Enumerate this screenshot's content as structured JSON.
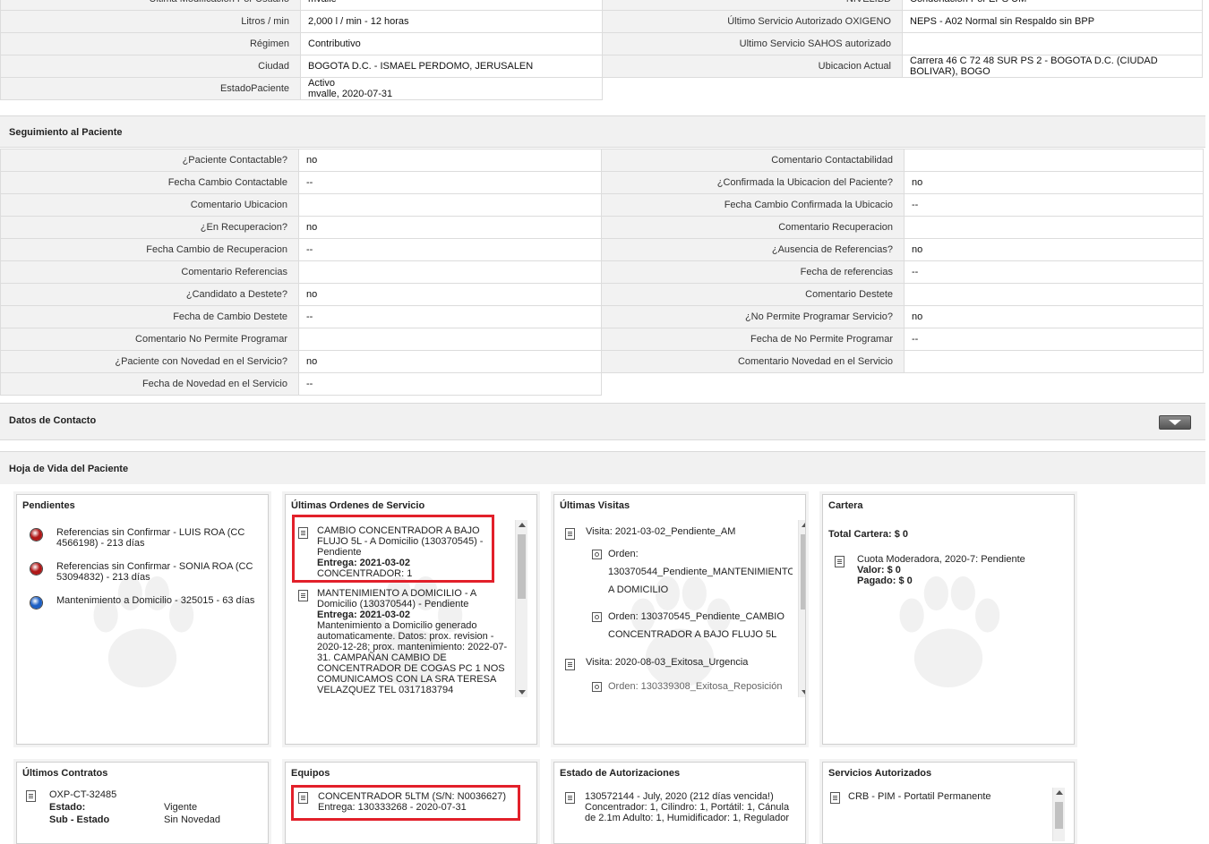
{
  "top_table": {
    "rows": [
      {
        "label": "Ultima Modificacion Por Usuario",
        "value": "mvalle",
        "label2": "NIVELIBD",
        "value2": "Condonación Por EPS UM"
      },
      {
        "label": "Litros / min",
        "value": "2,000 l / min - 12 horas",
        "label2": "Último Servicio Autorizado OXIGENO",
        "value2": "NEPS - A02 Normal sin Respaldo sin BPP"
      },
      {
        "label": "Régimen",
        "value": "Contributivo",
        "label2": "Ultimo Servicio SAHOS autorizado",
        "value2": ""
      },
      {
        "label": "Ciudad",
        "value": "BOGOTA D.C. - ISMAEL PERDOMO, JERUSALEN",
        "label2": "Ubicacion Actual",
        "value2": "Carrera 46 C 72 48 SUR PS 2 - BOGOTA D.C. (CIUDAD BOLIVAR), BOGO"
      }
    ],
    "estado_label": "EstadoPaciente",
    "estado_line1": "Activo",
    "estado_line2": "mvalle, 2020-07-31"
  },
  "seguimiento": {
    "title": "Seguimiento al Paciente",
    "left": [
      {
        "label": "¿Paciente Contactable?",
        "value": "no"
      },
      {
        "label": "Fecha Cambio Contactable",
        "value": "--"
      },
      {
        "label": "Comentario Ubicacion",
        "value": ""
      },
      {
        "label": "¿En Recuperacion?",
        "value": "no"
      },
      {
        "label": "Fecha Cambio de Recuperacion",
        "value": "--"
      },
      {
        "label": "Comentario Referencias",
        "value": ""
      },
      {
        "label": "¿Candidato a Destete?",
        "value": "no"
      },
      {
        "label": "Fecha de Cambio Destete",
        "value": "--"
      },
      {
        "label": "Comentario No Permite Programar",
        "value": ""
      },
      {
        "label": "¿Paciente con Novedad en el Servicio?",
        "value": "no"
      },
      {
        "label": "Fecha de Novedad en el Servicio",
        "value": "--"
      }
    ],
    "right": [
      {
        "label": "Comentario Contactabilidad",
        "value": ""
      },
      {
        "label": "¿Confirmada la Ubicacion del Paciente?",
        "value": "no"
      },
      {
        "label": "Fecha Cambio Confirmada la Ubicacio",
        "value": "--"
      },
      {
        "label": "Comentario Recuperacion",
        "value": ""
      },
      {
        "label": "¿Ausencia de Referencias?",
        "value": "no"
      },
      {
        "label": "Fecha de referencias",
        "value": "--"
      },
      {
        "label": "Comentario Destete",
        "value": ""
      },
      {
        "label": "¿No Permite Programar Servicio?",
        "value": "no"
      },
      {
        "label": "Fecha de No Permite Programar",
        "value": "--"
      },
      {
        "label": "Comentario Novedad en el Servicio",
        "value": ""
      }
    ]
  },
  "datos_contacto": {
    "title": "Datos de Contacto"
  },
  "hoja_vida": {
    "title": "Hoja de Vida del Paciente",
    "pendientes": {
      "title": "Pendientes",
      "items": [
        {
          "text": "Referencias sin Confirmar - LUIS ROA (CC 4566198) - 213 días",
          "color": "#b01818"
        },
        {
          "text": "Referencias sin Confirmar - SONIA ROA (CC 53094832) - 213 días",
          "color": "#b01818"
        },
        {
          "text": "Mantenimiento a Domicilio - 325015 - 63 días",
          "color": "#1c5fc4"
        }
      ]
    },
    "ordenes": {
      "title": "Últimas Ordenes de Servicio",
      "o1_text": "CAMBIO CONCENTRADOR A BAJO FLUJO 5L - A Domicilio (130370545) - Pendiente",
      "o1_entrega": "Entrega: 2021-03-02",
      "o1_detail": "CONCENTRADOR: 1",
      "o2_text": "MANTENIMIENTO A DOMICILIO - A Domicilio (130370544) - Pendiente",
      "o2_entrega": "Entrega: 2021-03-02",
      "o2_detail": "Mantenimiento a Domicilio generado automaticamente. Datos: prox. revision - 2020-12-28; prox. mantenimiento: 2022-07-31. CAMPAÑAN CAMBIO DE CONCENTRADOR DE COGAS PC 1 NOS COMUNICAMOS CON LA SRA TERESA VELAZQUEZ TEL 0317183794"
    },
    "visitas": {
      "title": "Últimas Visitas",
      "v1": "Visita: 2021-03-02_Pendiente_AM",
      "orden1_label": "Orden:",
      "orden1_text": "130370544_Pendiente_MANTENIMIENTO A DOMICILIO",
      "orden2_text": "Orden: 130370545_Pendiente_CAMBIO CONCENTRADOR A BAJO FLUJO 5L",
      "v2": "Visita: 2020-08-03_Exitosa_Urgencia",
      "cut": "Orden: 130339308_Exitosa_Reposición"
    },
    "cartera": {
      "title": "Cartera",
      "total": "Total Cartera: $ 0",
      "item": "Cuota Moderadora, 2020-7: Pendiente",
      "valor": "Valor: $ 0",
      "pagado": "Pagado: $ 0"
    },
    "contratos": {
      "title": "Últimos Contratos",
      "code": "OXP-CT-32485",
      "estado_label": "Estado:",
      "estado_value": "Vigente",
      "sub_label": "Sub - Estado",
      "sub_value": "Sin Novedad"
    },
    "equipos": {
      "title": "Equipos",
      "line1": "CONCENTRADOR 5LTM (S/N: N0036627)",
      "line2": "Entrega: 130333268 - 2020-07-31"
    },
    "autorizaciones": {
      "title": "Estado de Autorizaciones",
      "text": "130572144 - July, 2020 (212 días vencida!) Concentrador: 1, Cilindro: 1, Portátil: 1, Cánula de 2.1m Adulto: 1, Humidificador: 1, Regulador"
    },
    "servicios": {
      "title": "Servicios Autorizados",
      "item": "CRB - PIM - Portatil Permanente"
    }
  }
}
